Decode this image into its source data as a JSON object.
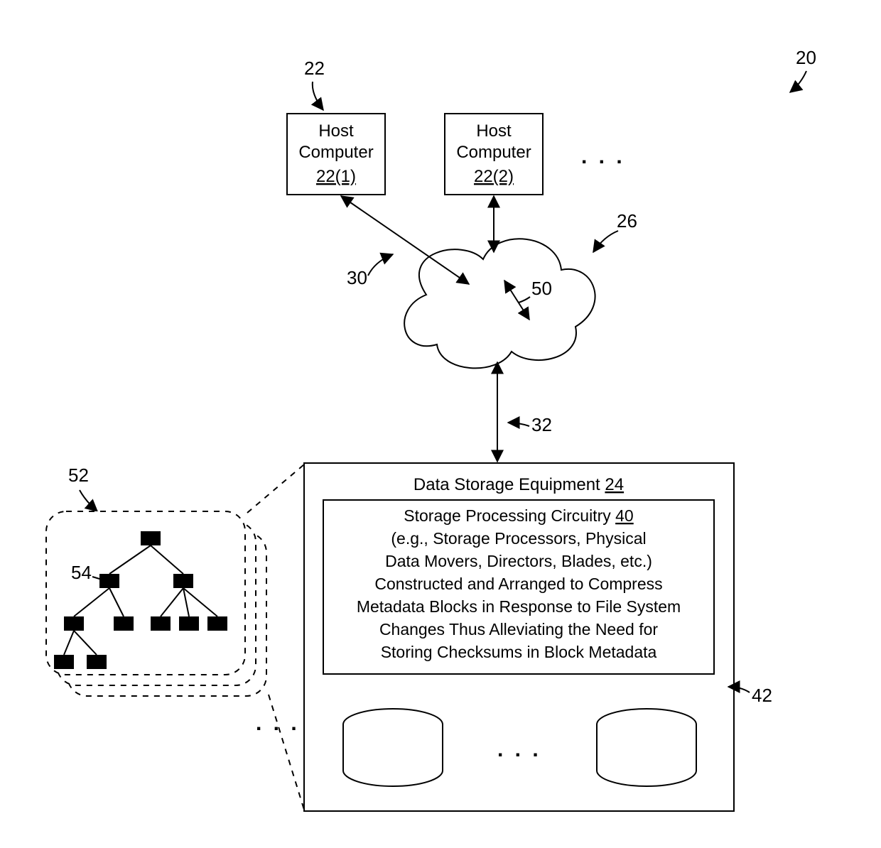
{
  "refs": {
    "r20": "20",
    "r22": "22",
    "r26": "26",
    "r30": "30",
    "r32": "32",
    "r40": "40",
    "r42": "42",
    "r50": "50",
    "r52": "52",
    "r54": "54"
  },
  "host1": {
    "line1": "Host",
    "line2": "Computer",
    "id": "22(1)"
  },
  "host2": {
    "line1": "Host",
    "line2": "Computer",
    "id": "22(2)"
  },
  "storage": {
    "title_prefix": "Data Storage Equipment ",
    "title_id": "24"
  },
  "circuitry": {
    "title_prefix": "Storage Processing Circuitry ",
    "title_id": "40",
    "line2": "(e.g., Storage Processors, Physical",
    "line3": "Data Movers, Directors, Blades, etc.)",
    "line4": "Constructed and Arranged to Compress",
    "line5": "Metadata Blocks in Response to File System",
    "line6": "Changes Thus Alleviating the Need for",
    "line7": "Storing Checksums in Block Metadata"
  },
  "ellipsis": ". . ."
}
